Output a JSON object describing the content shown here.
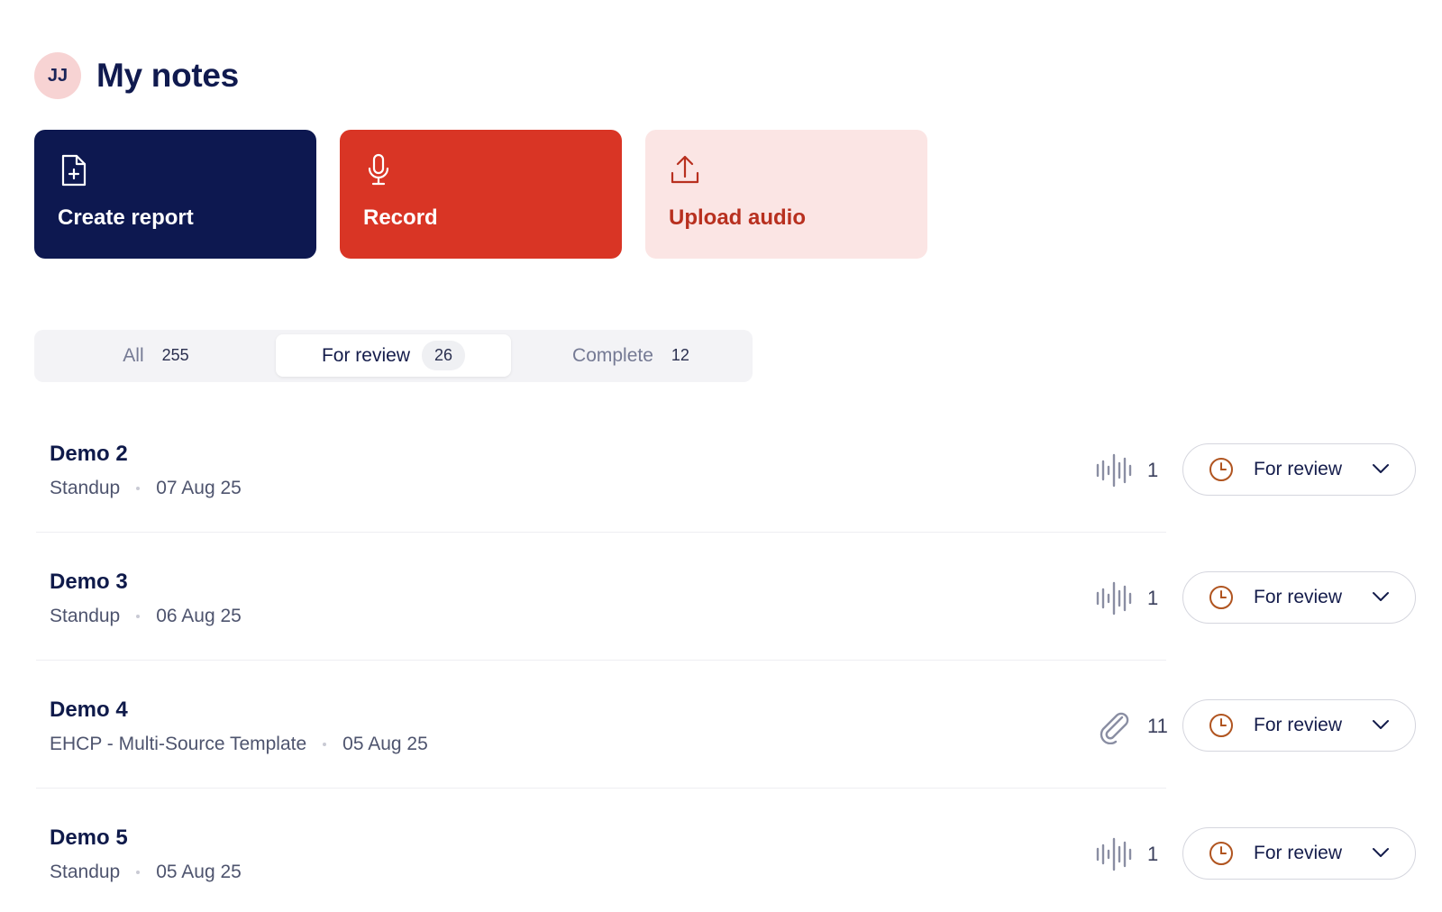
{
  "header": {
    "avatar_initials": "JJ",
    "title": "My notes"
  },
  "actions": [
    {
      "label": "Create report",
      "icon": "file-plus-icon"
    },
    {
      "label": "Record",
      "icon": "microphone-icon"
    },
    {
      "label": "Upload audio",
      "icon": "upload-icon"
    }
  ],
  "tabs": [
    {
      "label": "All",
      "count": "255",
      "active": false
    },
    {
      "label": "For review",
      "count": "26",
      "active": true
    },
    {
      "label": "Complete",
      "count": "12",
      "active": false
    }
  ],
  "notes": [
    {
      "title": "Demo 2",
      "template": "Standup",
      "date": "07 Aug 25",
      "source_icon": "audio-waveform-icon",
      "source_count": "1",
      "status": "For review"
    },
    {
      "title": "Demo 3",
      "template": "Standup",
      "date": "06 Aug 25",
      "source_icon": "audio-waveform-icon",
      "source_count": "1",
      "status": "For review"
    },
    {
      "title": "Demo 4",
      "template": "EHCP - Multi-Source Template",
      "date": "05 Aug 25",
      "source_icon": "paperclip-icon",
      "source_count": "11",
      "status": "For review"
    },
    {
      "title": "Demo 5",
      "template": "Standup",
      "date": "05 Aug 25",
      "source_icon": "audio-waveform-icon",
      "source_count": "1",
      "status": "For review"
    }
  ],
  "colors": {
    "navy": "#0d1850",
    "record_red": "#d93525",
    "upload_bg": "#fbe5e4",
    "upload_text": "#b8301f",
    "status_clock": "#b0541f"
  }
}
